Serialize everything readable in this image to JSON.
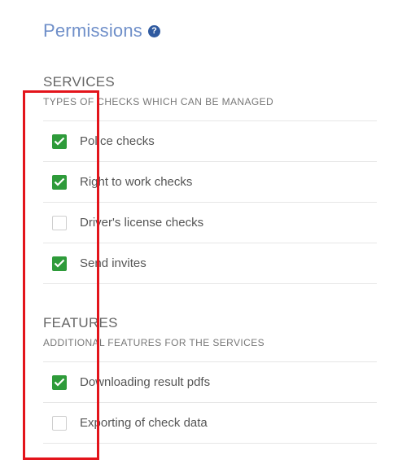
{
  "header": {
    "title": "Permissions",
    "help_icon": "help-circle-icon",
    "help_glyph": "?"
  },
  "colors": {
    "title": "#6f8fc9",
    "help_icon_bg": "#2f5aa0",
    "checkbox_checked": "#2e9b3a",
    "annotation": "#e3141b"
  },
  "services": {
    "heading": "SERVICES",
    "subheading": "TYPES OF CHECKS WHICH CAN BE MANAGED",
    "items": [
      {
        "label": "Police checks",
        "checked": true
      },
      {
        "label": "Right to work checks",
        "checked": true
      },
      {
        "label": "Driver's license checks",
        "checked": false
      },
      {
        "label": "Send invites",
        "checked": true
      }
    ]
  },
  "features": {
    "heading": "FEATURES",
    "subheading": "ADDITIONAL FEATURES FOR THE SERVICES",
    "items": [
      {
        "label": "Downloading result pdfs",
        "checked": true
      },
      {
        "label": "Exporting of check data",
        "checked": false
      }
    ]
  }
}
